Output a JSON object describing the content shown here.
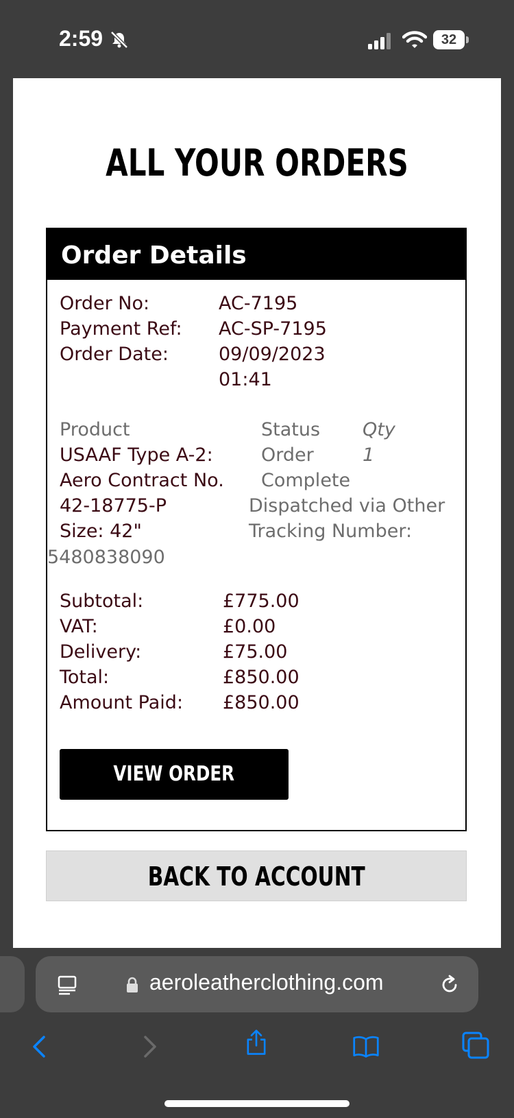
{
  "status_bar": {
    "time": "2:59",
    "battery": "32"
  },
  "page": {
    "title": "ALL YOUR ORDERS",
    "order": {
      "header": "Order Details",
      "fields": [
        {
          "label": "Order No:",
          "value": "AC-7195"
        },
        {
          "label": "Payment Ref:",
          "value": "AC-SP-7195"
        },
        {
          "label": "Order Date:",
          "value": "09/09/2023",
          "value2": "01:41"
        }
      ],
      "items_header": {
        "product": "Product",
        "status": "Status",
        "qty": "Qty"
      },
      "item": {
        "product_lines": [
          "USAAF Type A-2:",
          "Aero Contract No.",
          "42-18775-P",
          "Size: 42\""
        ],
        "status_lines": [
          "Order",
          "Complete"
        ],
        "qty": "1",
        "dispatch": "Dispatched via Other",
        "tracking_label": "Tracking Number:",
        "tracking_number": "5480838090"
      },
      "totals": [
        {
          "label": "Subtotal:",
          "value": "£775.00"
        },
        {
          "label": "VAT:",
          "value": "£0.00"
        },
        {
          "label": "Delivery:",
          "value": "£75.00"
        },
        {
          "label": "Total:",
          "value": "£850.00"
        },
        {
          "label": "Amount Paid:",
          "value": "£850.00"
        }
      ],
      "view_button": "VIEW ORDER"
    },
    "back_button": "BACK TO ACCOUNT"
  },
  "browser": {
    "url": "aeroleatherclothing.com"
  },
  "colors": {
    "label": "#3b0a14",
    "muted": "#6d6d6d",
    "chrome": "#3d3d3d",
    "accent_icon": "#0a84ff"
  }
}
